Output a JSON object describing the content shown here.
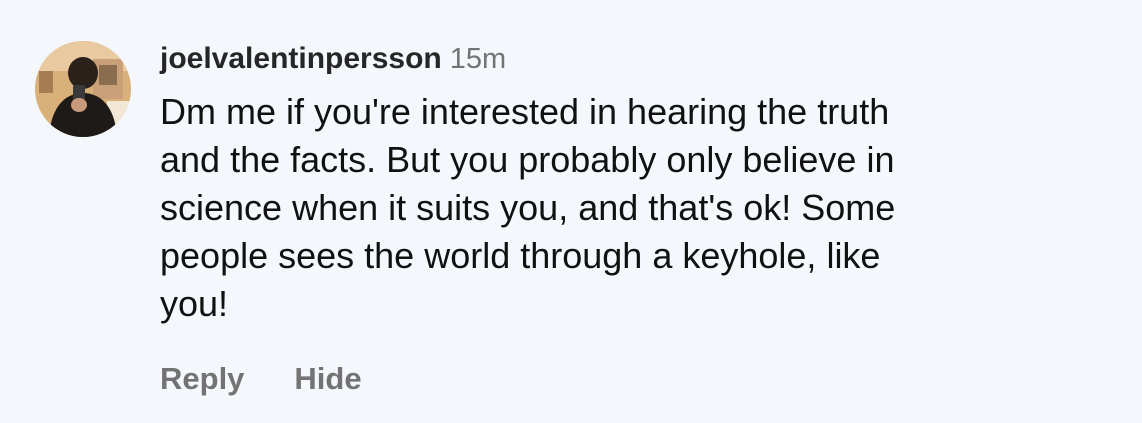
{
  "comment": {
    "username": "joelvalentinpersson",
    "timestamp": "15m",
    "text_lines": [
      "Dm me if you're interested in hearing the truth",
      "and the facts. But you probably only believe in",
      "science when it suits you, and that's ok! Some",
      "people sees the world through a keyhole, like",
      "you!"
    ],
    "actions": {
      "reply_label": "Reply",
      "hide_label": "Hide"
    }
  },
  "colors": {
    "background": "#f4f8fc",
    "text_primary": "#111111",
    "text_secondary": "#737373"
  }
}
